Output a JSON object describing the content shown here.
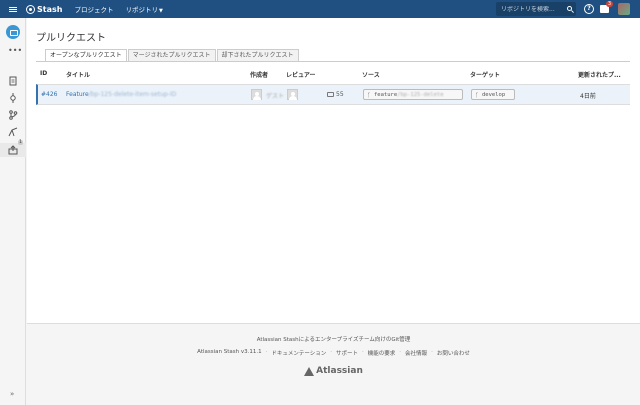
{
  "topbar": {
    "brand": "Stash",
    "nav": [
      {
        "label": "プロジェクト"
      },
      {
        "label": "リポジトリ"
      }
    ],
    "search_placeholder": "リポジトリを検索...",
    "help_label": "?",
    "inbox_count": "3",
    "colors": {
      "bar": "#205081",
      "badge": "#d04437"
    }
  },
  "sidebar": {
    "more_label": "•••",
    "pr_count": "1",
    "collapse_label": "»"
  },
  "page": {
    "title": "プルリクエスト",
    "tabs": [
      {
        "label": "オープンなプルリクエスト",
        "active": true
      },
      {
        "label": "マージされたプルリクエスト",
        "active": false
      },
      {
        "label": "却下されたプルリクエスト",
        "active": false
      }
    ],
    "columns": {
      "id": "ID",
      "title": "タイトル",
      "author": "作成者",
      "reviewers": "レビュアー",
      "source": "ソース",
      "target": "ターゲット",
      "updated": "更新されたプ..."
    },
    "rows": [
      {
        "id": "#426",
        "title": "Feature",
        "title_blurred": "/bp-125-delete-item-setup-ID",
        "author_name_blurred": "ゲスト",
        "comments": "55",
        "source_branch": "feature",
        "source_blurred": "/bp-125-delete",
        "target_branch": "develop",
        "updated": "4日前"
      }
    ]
  },
  "footer": {
    "line1": "Atlassian Stashによるエンタープライズチーム向けのGit管理",
    "links": [
      "Atlassian Stash v3.11.1",
      "ドキュメンテーション",
      "サポート",
      "機能の要求",
      "会社情報",
      "お問い合わせ"
    ],
    "separator": "·",
    "logo_text": "Atlassian"
  }
}
